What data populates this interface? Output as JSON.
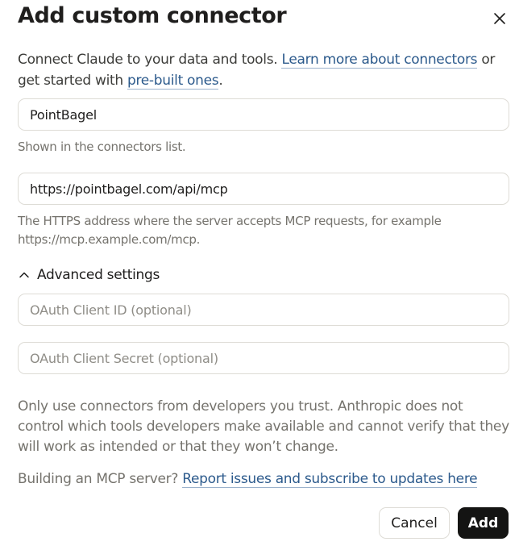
{
  "dialog": {
    "title": "Add custom connector",
    "intro": {
      "text_before": "Connect Claude to your data and tools. ",
      "learn_more_link": "Learn more about connectors",
      "text_middle": " or get started with ",
      "prebuilt_link": "pre-built ones",
      "text_after": "."
    },
    "name_field": {
      "value": "PointBagel",
      "help": "Shown in the connectors list."
    },
    "url_field": {
      "value": "https://pointbagel.com/api/mcp",
      "help": "The HTTPS address where the server accepts MCP requests, for example https://mcp.example.com/mcp."
    },
    "advanced": {
      "label": "Advanced settings",
      "expanded": true,
      "client_id_placeholder": "OAuth Client ID (optional)",
      "client_secret_placeholder": "OAuth Client Secret (optional)"
    },
    "warning": "Only use connectors from developers you trust. Anthropic does not control which tools developers make available and cannot verify that they will work as intended or that they won’t change.",
    "building": {
      "text": "Building an MCP server? ",
      "link": "Report issues and subscribe to updates here"
    },
    "buttons": {
      "cancel": "Cancel",
      "add": "Add"
    }
  },
  "colors": {
    "link": "#2c5a8c",
    "primary_button": "#141413",
    "muted_text": "#75736d",
    "border": "#dedcd6"
  },
  "icons": {
    "close": "close-icon",
    "advanced_toggle": "chevron-up-icon"
  }
}
